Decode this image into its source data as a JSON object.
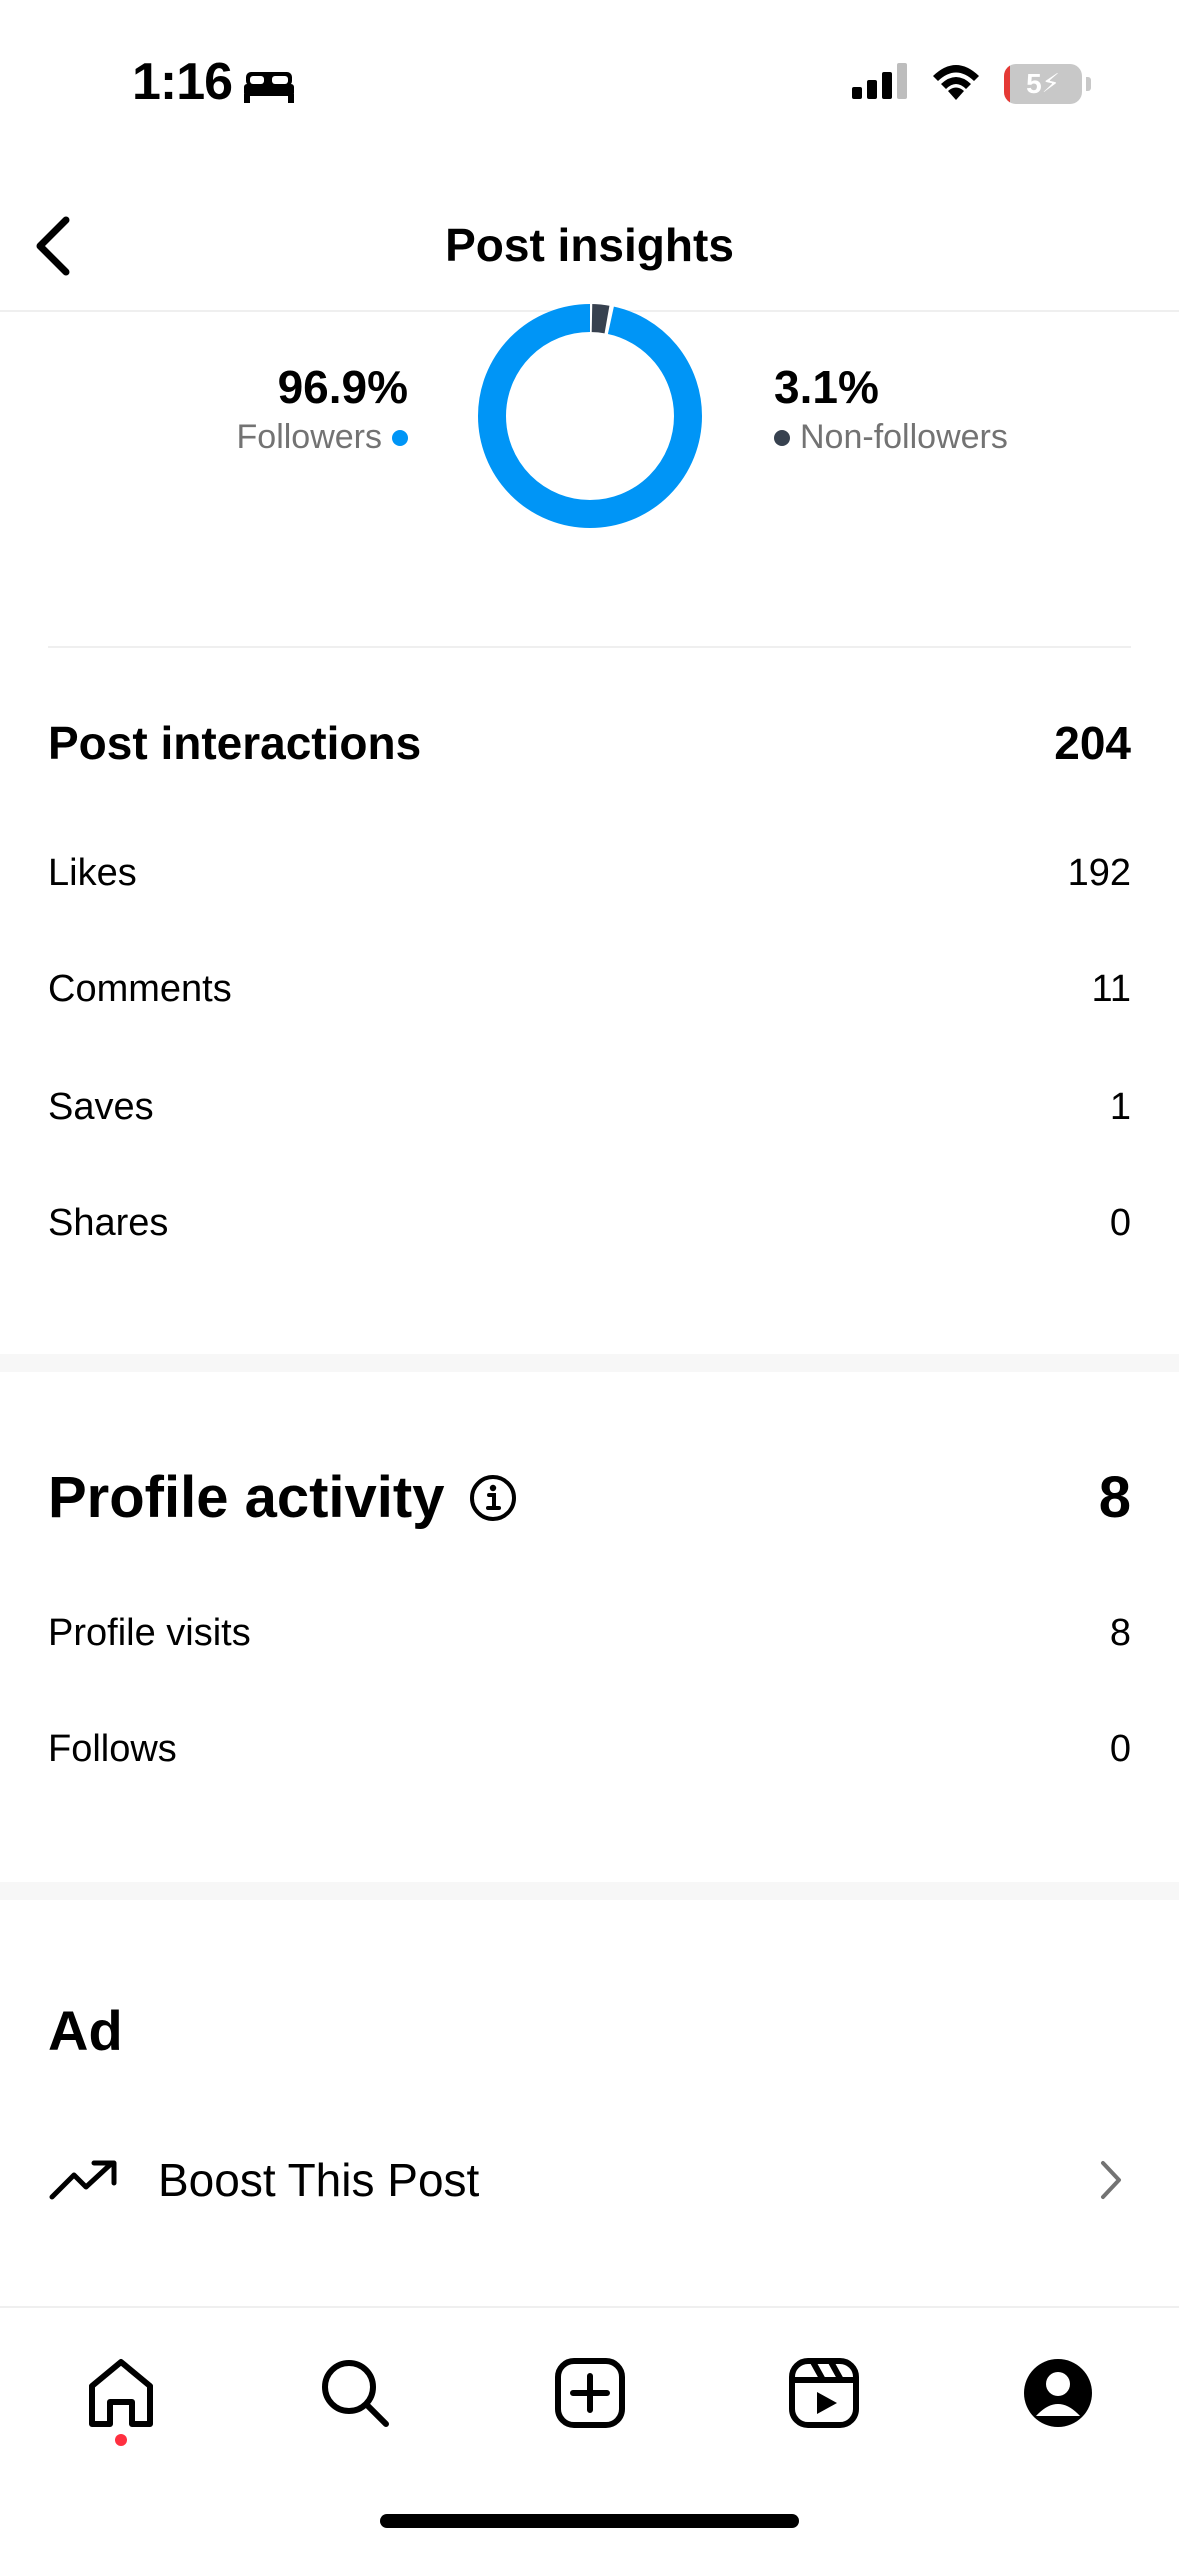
{
  "status": {
    "time": "1:16",
    "battery": "5"
  },
  "header": {
    "title": "Post insights"
  },
  "audience": {
    "followers": {
      "percent": "96.9%",
      "label": "Followers",
      "color": "#0095f6",
      "fraction": 0.969
    },
    "non_followers": {
      "percent": "3.1%",
      "label": "Non-followers",
      "color": "#37414f",
      "fraction": 0.031
    }
  },
  "post_interactions": {
    "title": "Post interactions",
    "total": "204",
    "rows": [
      {
        "label": "Likes",
        "value": "192"
      },
      {
        "label": "Comments",
        "value": "11"
      },
      {
        "label": "Saves",
        "value": "1"
      },
      {
        "label": "Shares",
        "value": "0"
      }
    ]
  },
  "profile_activity": {
    "title": "Profile activity",
    "total": "8",
    "rows": [
      {
        "label": "Profile visits",
        "value": "8"
      },
      {
        "label": "Follows",
        "value": "0"
      }
    ]
  },
  "ad": {
    "title": "Ad",
    "boost_label": "Boost This Post"
  },
  "icons": {
    "back": "chevron-left-icon",
    "info": "info-icon",
    "trend": "trending-up-icon",
    "chevron": "chevron-right-icon",
    "tabs": [
      "home-icon",
      "search-icon",
      "create-icon",
      "reels-icon",
      "profile-icon"
    ]
  }
}
